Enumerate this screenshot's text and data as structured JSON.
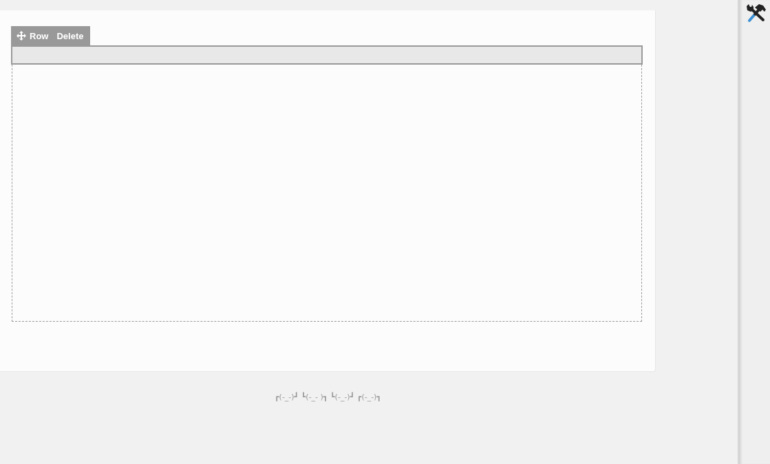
{
  "row_toolbar": {
    "items": [
      {
        "kind": "move",
        "label": "Row"
      },
      {
        "kind": "delete",
        "label": "Delete"
      }
    ]
  },
  "footer": {
    "text": "┏(-_-)┛ ┗(-_- )┓ ┗(-_-)┛ ┏(-_-)┓"
  }
}
